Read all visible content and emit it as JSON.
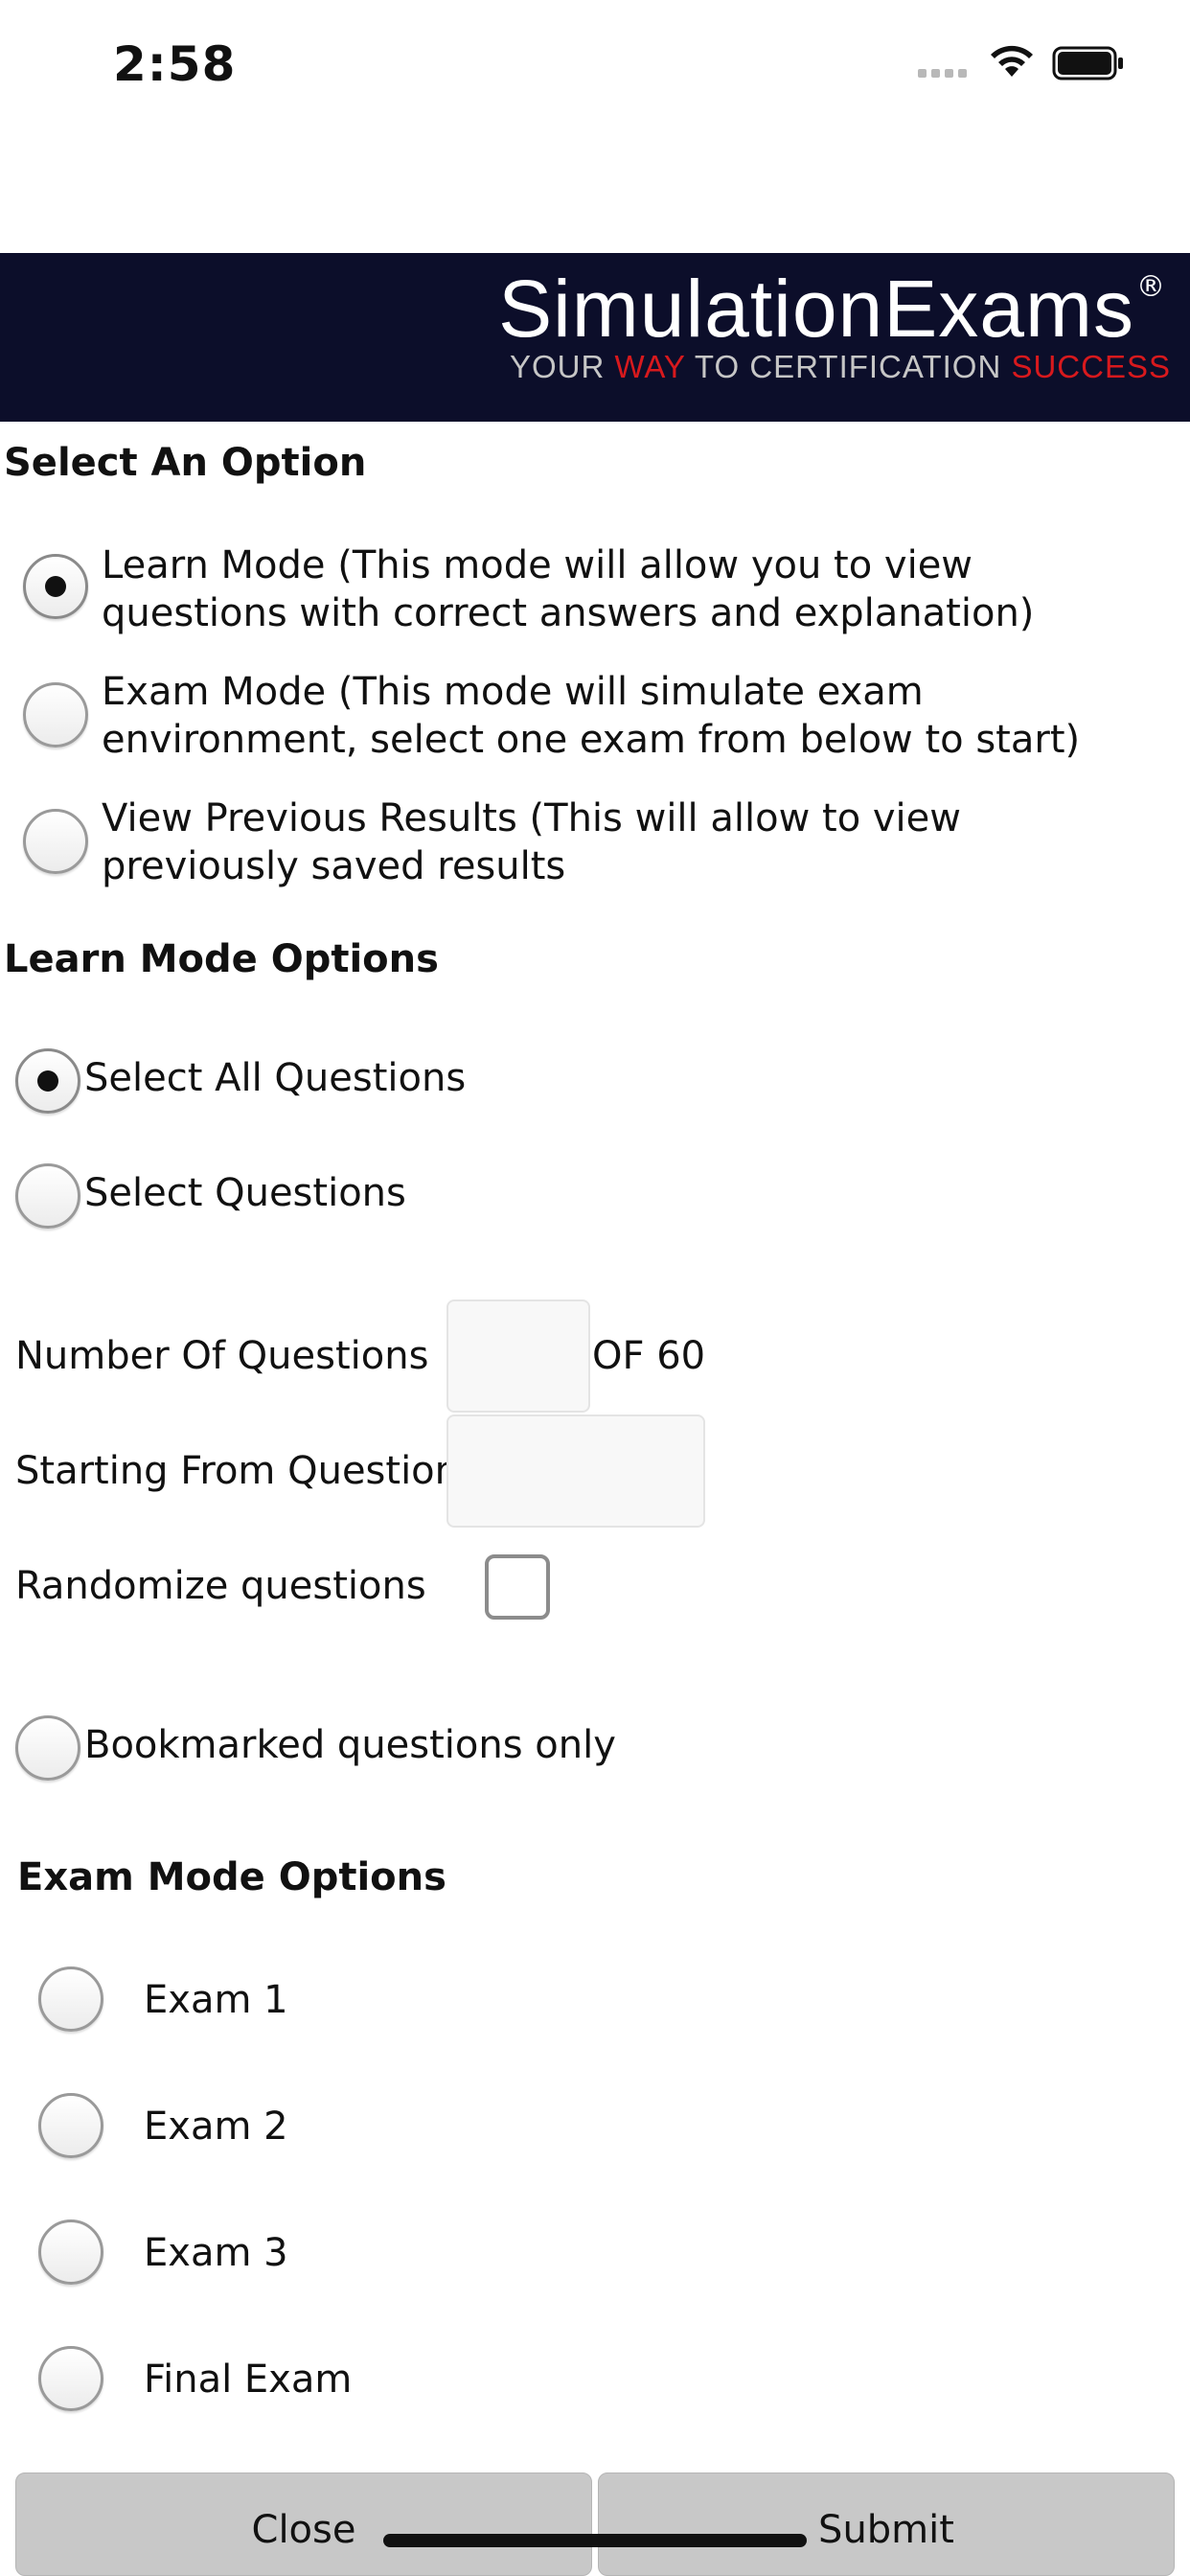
{
  "status_bar": {
    "time": "2:58",
    "icons": [
      "signal-icon",
      "wifi-icon",
      "battery-icon"
    ]
  },
  "banner": {
    "brand": "SimulationExams",
    "registered": "®",
    "tagline_part1": "YOUR ",
    "tagline_highlight1": "WAY",
    "tagline_part2": " TO CERTIFICATION ",
    "tagline_highlight2": "SUCCESS",
    "colors": {
      "background": "#0c0e2a",
      "highlight": "#d8191d"
    }
  },
  "select_option": {
    "title": "Select An Option",
    "options": [
      {
        "label": "Learn Mode (This mode will allow you to view questions with correct answers and explanation)",
        "checked": true
      },
      {
        "label": "Exam Mode (This mode will simulate exam environment, select one exam from below to start)",
        "checked": false
      },
      {
        "label": "View Previous Results (This will allow to view previously saved results",
        "checked": false
      }
    ]
  },
  "learn_mode": {
    "title": "Learn Mode Options",
    "select_all_label": "Select All Questions",
    "select_questions_label": "Select Questions",
    "number_of_questions_label": "Number Of Questions",
    "number_of_questions_value": "",
    "of_total": "OF 60",
    "starting_from_label": "Starting From Question",
    "starting_from_value": "",
    "randomize_label": "Randomize questions",
    "randomize_checked": false,
    "bookmarked_label": "Bookmarked questions only"
  },
  "exam_mode": {
    "title": "Exam Mode Options",
    "exams": [
      "Exam 1",
      "Exam 2",
      "Exam 3",
      "Final Exam"
    ]
  },
  "buttons": {
    "close": "Close",
    "submit": "Submit"
  }
}
